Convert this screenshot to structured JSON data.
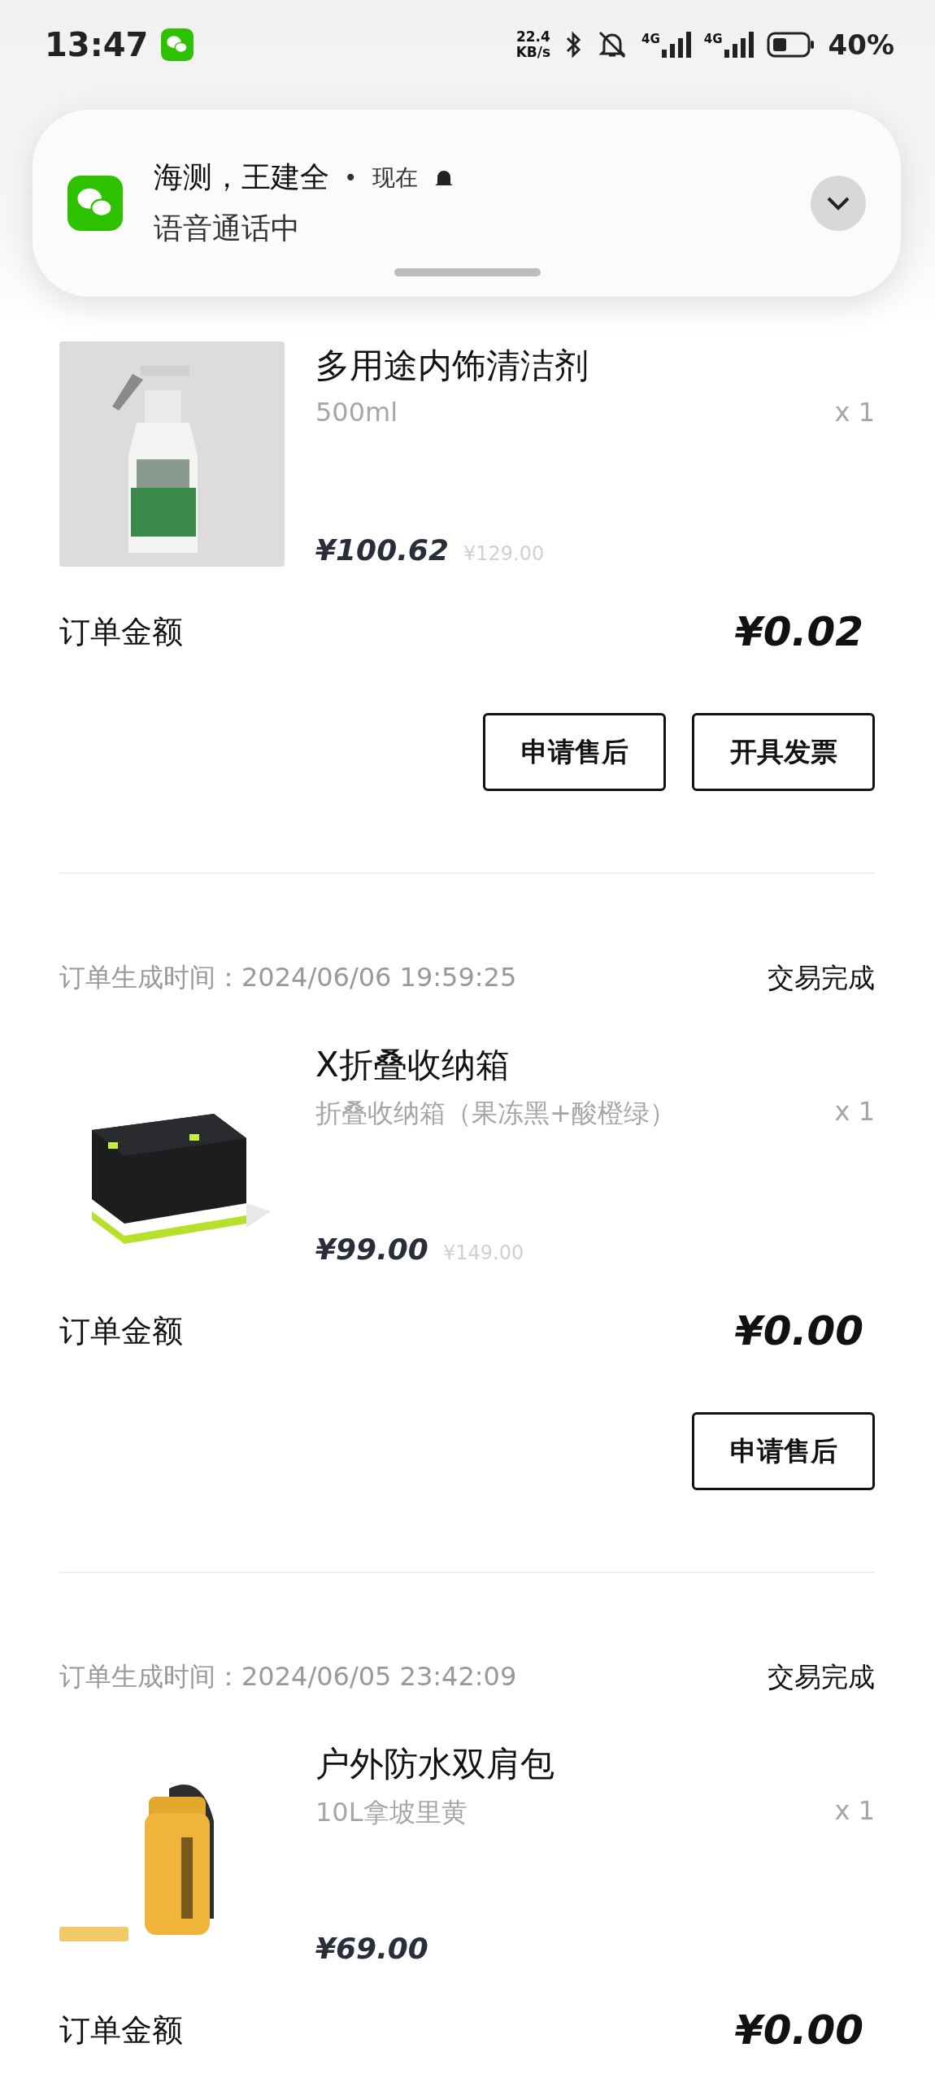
{
  "status_bar": {
    "time": "13:47",
    "net_speed": "22.4",
    "net_unit": "KB/s",
    "networks": [
      "4G",
      "4G"
    ],
    "battery": "40%"
  },
  "notification": {
    "sender": "海测，王建全",
    "separator": "•",
    "time": "现在",
    "message": "语音通话中"
  },
  "orders": [
    {
      "product": {
        "name": "多用途内饰清洁剂",
        "spec": "500ml",
        "quantity": "x 1",
        "price": "¥100.62",
        "original_price": "¥129.00"
      },
      "total_label": "订单金额",
      "total": "¥0.02",
      "buttons": [
        "申请售后",
        "开具发票"
      ]
    },
    {
      "time_label": "订单生成时间：",
      "time": "2024/06/06 19:59:25",
      "status": "交易完成",
      "product": {
        "name": "X折叠收纳箱",
        "spec": "折叠收纳箱（果冻黑+酸橙绿）",
        "quantity": "x 1",
        "price": "¥99.00",
        "original_price": "¥149.00"
      },
      "total_label": "订单金额",
      "total": "¥0.00",
      "buttons": [
        "申请售后"
      ]
    },
    {
      "time_label": "订单生成时间：",
      "time": "2024/06/05 23:42:09",
      "status": "交易完成",
      "product": {
        "name": "户外防水双肩包",
        "spec": "10L拿坡里黄",
        "quantity": "x 1",
        "price": "¥69.00"
      },
      "total_label": "订单金额",
      "total": "¥0.00"
    }
  ]
}
